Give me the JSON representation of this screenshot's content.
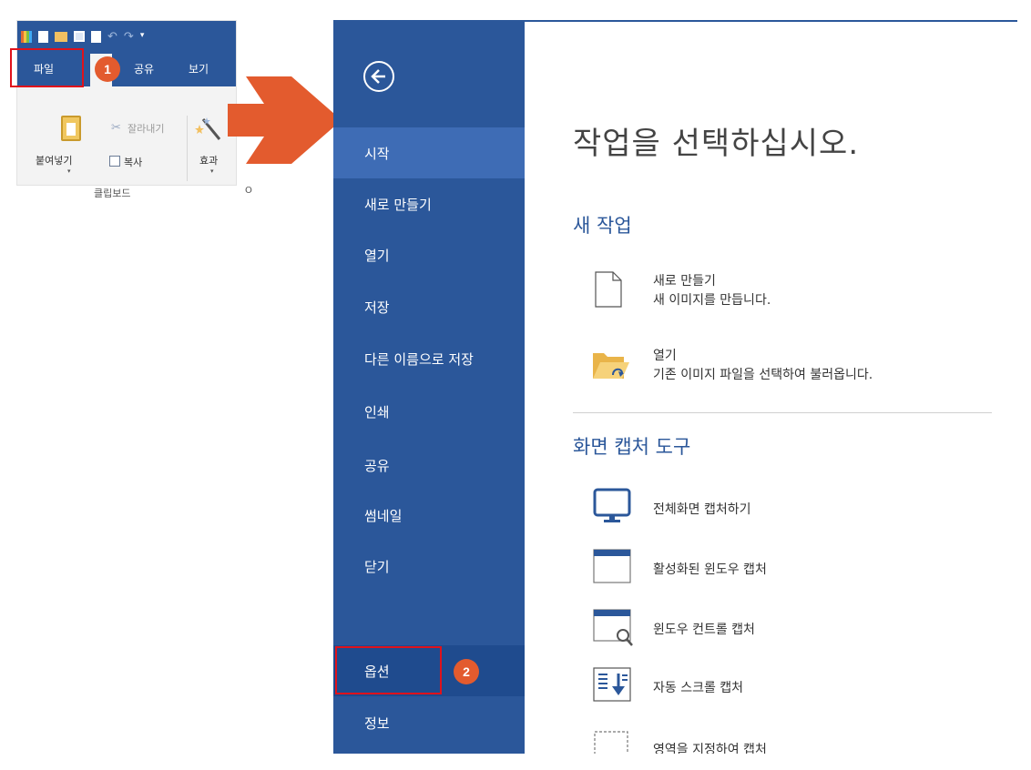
{
  "ribbon": {
    "tabs": {
      "file": "파일",
      "share": "공유",
      "view": "보기"
    },
    "cut_label": "잘라내기",
    "paste_label": "붙여넣기",
    "copy_label": "복사",
    "effect_label": "효과",
    "group_label": "클립보드",
    "truncated_group": "O",
    "dropdown_marker": "▾"
  },
  "badges": {
    "step1": "1",
    "step2": "2"
  },
  "annotation_color": "#e0121b",
  "badge_color": "#e35b2e",
  "arrow_color": "#e35b2e",
  "backstage": {
    "accent": "#2b579a",
    "menu": [
      {
        "label": "시작",
        "state": "active"
      },
      {
        "label": "새로 만들기"
      },
      {
        "label": "열기"
      },
      {
        "label": "저장"
      },
      {
        "label": "다른 이름으로 저장"
      },
      {
        "label": "인쇄"
      },
      {
        "label": "공유"
      },
      {
        "label": "썸네일"
      },
      {
        "label": "닫기"
      },
      {
        "label": "옵션",
        "state": "selected"
      },
      {
        "label": "정보"
      }
    ],
    "title": "작업을 선택하십시오.",
    "new_section": {
      "heading": "새 작업",
      "items": [
        {
          "title": "새로 만들기",
          "desc": "새 이미지를 만듭니다.",
          "icon": "new-document-icon"
        },
        {
          "title": "열기",
          "desc": "기존 이미지 파일을 선택하여 불러옵니다.",
          "icon": "open-folder-icon"
        }
      ]
    },
    "capture_section": {
      "heading": "화면 캡처 도구",
      "items": [
        {
          "label": "전체화면 캡처하기",
          "icon": "monitor-icon"
        },
        {
          "label": "활성화된 윈도우 캡처",
          "icon": "window-icon"
        },
        {
          "label": "윈도우 컨트롤 캡처",
          "icon": "window-search-icon"
        },
        {
          "label": "자동 스크롤 캡처",
          "icon": "scroll-capture-icon"
        },
        {
          "label": "영역을 지정하여 캡처",
          "icon": "region-select-icon"
        }
      ]
    }
  }
}
